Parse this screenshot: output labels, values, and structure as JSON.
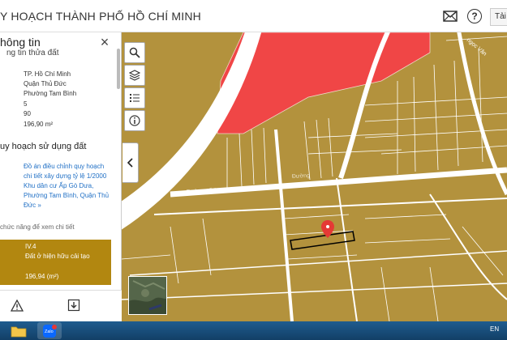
{
  "header": {
    "title": "Y HOẠCH THÀNH PHỐ HỒ CHÍ MINH",
    "edge_button": "Tải"
  },
  "panel": {
    "title": "hông tin",
    "subtitle_cut": "ng tin thửa đất",
    "rows": [
      "TP. Hồ Chí Minh",
      "Quận Thủ Đức",
      "Phường Tam Bình",
      "5",
      "90",
      "196,90 m²"
    ],
    "section2_title": "uy hoạch sử dụng đất",
    "plan_link": "Đồ án điều chỉnh quy hoạch chi tiết xây dựng tỷ lệ 1/2000 Khu dân cư Ấp Gò Dưa, Phường Tam Bình, Quận Thủ Đức »",
    "hint": "chức năng để xem chi tiết",
    "zone": {
      "code": "IV.4",
      "name": "Đất ở hiện hữu cải tạo",
      "area": "196,94 (m²)"
    }
  },
  "map": {
    "road_label_1": "Đường số 9",
    "road_label_2": "Đường số 9",
    "road_label_3": "Đường",
    "road_label_4": "ngọc Vân",
    "colors": {
      "residential": "#b3923d",
      "public": "#f04646",
      "road": "#ffffff",
      "selected_outline": "#000000",
      "pin": "#e53935"
    }
  },
  "taskbar": {
    "lang": "EN",
    "zalo_label": "Zalo"
  },
  "icons": [
    "envelope-icon",
    "help-icon",
    "close-icon",
    "search-icon",
    "layers-icon",
    "legend-icon",
    "info-icon",
    "chevron-left-icon",
    "warning-icon",
    "download-icon",
    "folder-icon",
    "zalo-icon",
    "map-pin-icon"
  ]
}
